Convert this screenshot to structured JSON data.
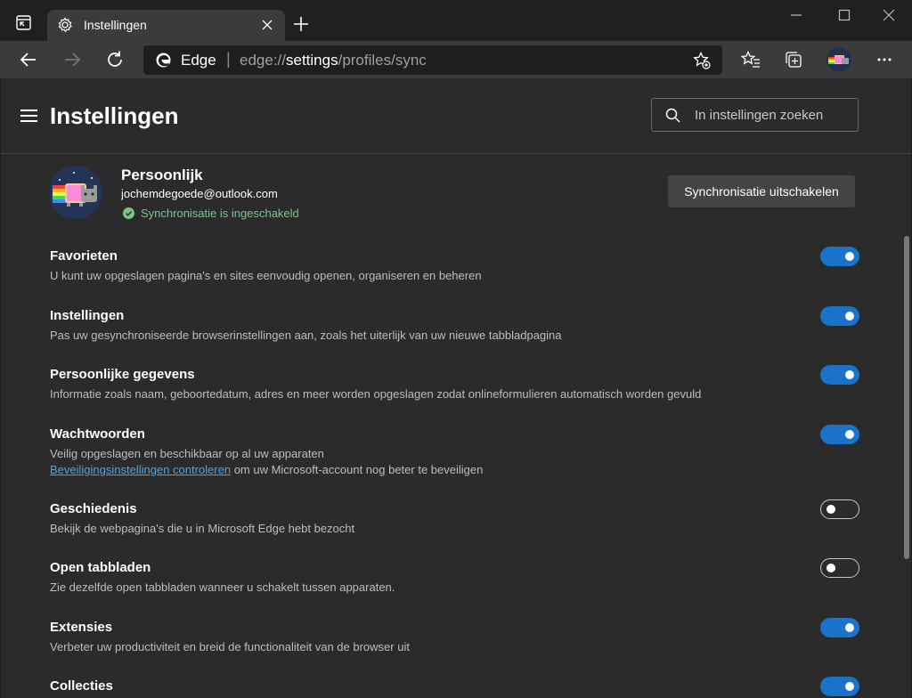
{
  "window": {
    "tab_title": "Instellingen",
    "controls": [
      "minimize",
      "maximize",
      "close"
    ]
  },
  "navbar": {
    "omnibox_brand": "Edge",
    "url_prefix": "edge://",
    "url_highlight": "settings",
    "url_suffix": "/profiles/sync"
  },
  "header": {
    "title": "Instellingen",
    "search_placeholder": "In instellingen zoeken"
  },
  "profile": {
    "name": "Persoonlijk",
    "email": "jochemdegoede@outlook.com",
    "sync_status": "Synchronisatie is ingeschakeld",
    "disable_button": "Synchronisatie uitschakelen"
  },
  "settings": [
    {
      "title": "Favorieten",
      "desc": "U kunt uw opgeslagen pagina's en sites eenvoudig openen, organiseren en beheren",
      "on": true
    },
    {
      "title": "Instellingen",
      "desc": "Pas uw gesynchroniseerde browserinstellingen aan, zoals het uiterlijk van uw nieuwe tabbladpagina",
      "on": true
    },
    {
      "title": "Persoonlijke gegevens",
      "desc": "Informatie zoals naam, geboortedatum, adres en meer worden opgeslagen zodat onlineformulieren automatisch worden gevuld",
      "on": true
    },
    {
      "title": "Wachtwoorden",
      "desc": "Veilig opgeslagen en beschikbaar op al uw apparaten",
      "link": "Beveiligingsinstellingen controleren",
      "link_suffix": " om uw Microsoft-account nog beter te beveiligen",
      "on": true
    },
    {
      "title": "Geschiedenis",
      "desc": "Bekijk de webpagina's die u in Microsoft Edge hebt bezocht",
      "on": false
    },
    {
      "title": "Open tabbladen",
      "desc": "Zie dezelfde open tabbladen wanneer u schakelt tussen apparaten.",
      "on": false
    },
    {
      "title": "Extensies",
      "desc": "Verbeter uw productiviteit en breid de functionaliteit van de browser uit",
      "on": true
    },
    {
      "title": "Collecties",
      "desc": "",
      "on": true
    }
  ],
  "colors": {
    "accent": "#1a73c8",
    "sync_ok": "#7cc58e",
    "link": "#4ba5e8"
  }
}
